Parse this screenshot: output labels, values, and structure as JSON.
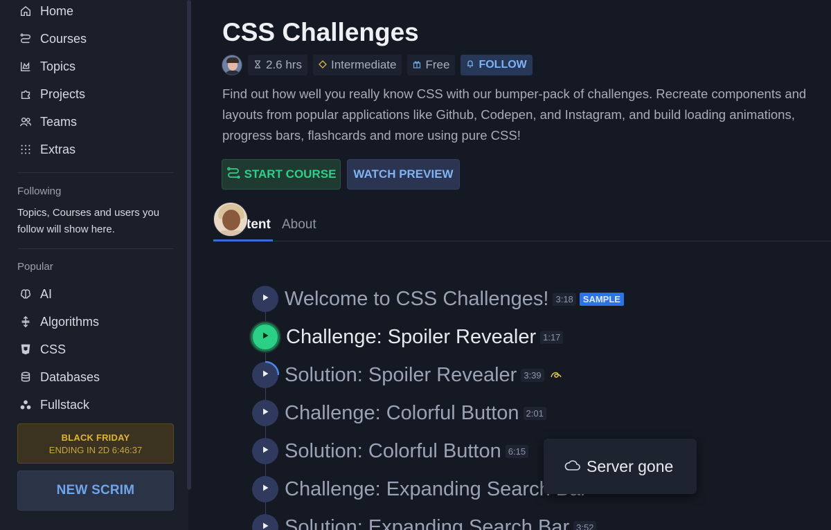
{
  "sidebar": {
    "nav": [
      {
        "label": "Home",
        "icon": "home-icon"
      },
      {
        "label": "Courses",
        "icon": "courses-icon"
      },
      {
        "label": "Topics",
        "icon": "topics-icon"
      },
      {
        "label": "Projects",
        "icon": "projects-icon"
      },
      {
        "label": "Teams",
        "icon": "teams-icon"
      },
      {
        "label": "Extras",
        "icon": "extras-icon"
      }
    ],
    "following_heading": "Following",
    "following_text": "Topics, Courses and users you follow will show here.",
    "popular_heading": "Popular",
    "popular": [
      {
        "label": "AI",
        "icon": "brain-icon"
      },
      {
        "label": "Algorithms",
        "icon": "algorithms-icon"
      },
      {
        "label": "CSS",
        "icon": "css-icon"
      },
      {
        "label": "Databases",
        "icon": "database-icon"
      },
      {
        "label": "Fullstack",
        "icon": "fullstack-icon"
      }
    ],
    "promo_title": "BLACK FRIDAY",
    "promo_countdown": "ENDING IN 2D 6:46:37",
    "new_scrim_label": "NEW SCRIM"
  },
  "course": {
    "title": "CSS Challenges",
    "duration": "2.6 hrs",
    "level": "Intermediate",
    "price": "Free",
    "follow_label": "FOLLOW",
    "description": "Find out how well you really know CSS with our bumper-pack of challenges. Recreate components and layouts from popular applications like Github, Codepen, and Instagram, and build loading animations, progress bars, flashcards and more using pure CSS!",
    "start_label": "START COURSE",
    "preview_label": "WATCH PREVIEW"
  },
  "tabs": [
    {
      "label": "tent",
      "active": true
    },
    {
      "label": "About",
      "active": false
    }
  ],
  "lessons": [
    {
      "title": "Welcome to CSS Challenges!",
      "duration": "3:18",
      "badge": "SAMPLE"
    },
    {
      "title": "Challenge: Spoiler Revealer",
      "duration": "1:17",
      "state": "current"
    },
    {
      "title": "Solution: Spoiler Revealer",
      "duration": "3:39",
      "state": "in-progress"
    },
    {
      "title": "Challenge: Colorful Button",
      "duration": "2:01"
    },
    {
      "title": "Solution: Colorful Button",
      "duration": "6:15"
    },
    {
      "title": "Challenge: Expanding Search Bar",
      "duration": ""
    },
    {
      "title": "Solution: Expanding Search Bar",
      "duration": "3:52"
    }
  ],
  "toast": {
    "text": "Server gone",
    "icon": "cloud-icon"
  },
  "colors": {
    "accent_green": "#2fcf88",
    "accent_blue": "#7fb3f5",
    "promo_gold": "#e0b43a",
    "sample_badge": "#2b73e8"
  }
}
